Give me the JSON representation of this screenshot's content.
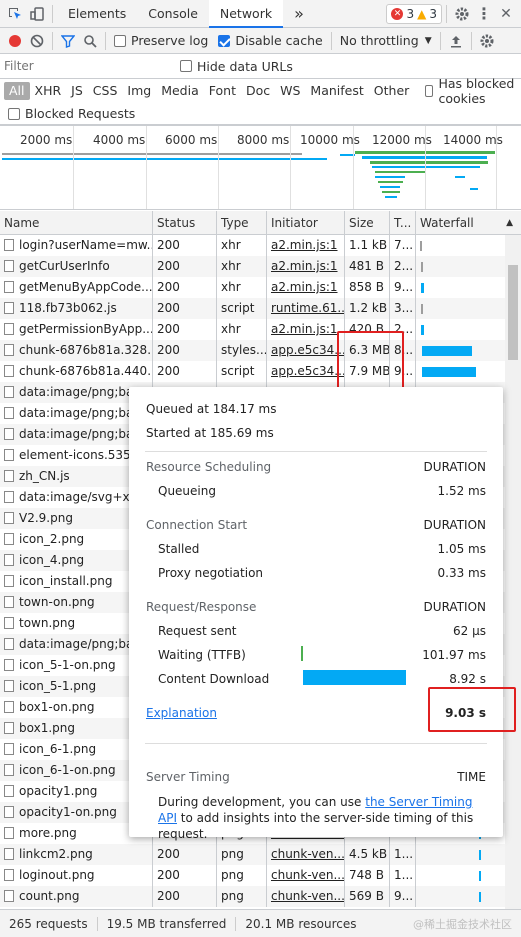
{
  "tabs": {
    "elements": "Elements",
    "console": "Console",
    "network": "Network",
    "more": "»",
    "errors": "3",
    "warnings": "3"
  },
  "toolbar": {
    "preserve_log": "Preserve log",
    "disable_cache": "Disable cache",
    "throttling": "No throttling"
  },
  "filter": {
    "placeholder": "Filter",
    "hide_data_urls": "Hide data URLs",
    "has_blocked_cookies": "Has blocked cookies",
    "blocked_requests": "Blocked Requests"
  },
  "types": [
    "All",
    "XHR",
    "JS",
    "CSS",
    "Img",
    "Media",
    "Font",
    "Doc",
    "WS",
    "Manifest",
    "Other"
  ],
  "overview_ticks": [
    "2000 ms",
    "4000 ms",
    "6000 ms",
    "8000 ms",
    "10000 ms",
    "12000 ms",
    "14000 ms"
  ],
  "columns": {
    "name": "Name",
    "status": "Status",
    "type": "Type",
    "initiator": "Initiator",
    "size": "Size",
    "time": "T...",
    "waterfall": "Waterfall"
  },
  "rows": [
    {
      "name": "login?userName=mw...",
      "status": "200",
      "type": "xhr",
      "initiator": "a2.min.js:1",
      "size": "1.1 kB",
      "time": "7..."
    },
    {
      "name": "getCurUserInfo",
      "status": "200",
      "type": "xhr",
      "initiator": "a2.min.js:1",
      "size": "481 B",
      "time": "2..."
    },
    {
      "name": "getMenuByAppCode...",
      "status": "200",
      "type": "xhr",
      "initiator": "a2.min.js:1",
      "size": "858 B",
      "time": "9..."
    },
    {
      "name": "118.fb73b062.js",
      "status": "200",
      "type": "script",
      "initiator": "runtime.61...",
      "size": "1.2 kB",
      "time": "3..."
    },
    {
      "name": "getPermissionByApp...",
      "status": "200",
      "type": "xhr",
      "initiator": "a2.min.js:1",
      "size": "420 B",
      "time": "2..."
    },
    {
      "name": "chunk-6876b81a.328...",
      "status": "200",
      "type": "styles...",
      "initiator": "app.e5c34...",
      "size": "6.3 MB",
      "time": "8..."
    },
    {
      "name": "chunk-6876b81a.440...",
      "status": "200",
      "type": "script",
      "initiator": "app.e5c34...",
      "size": "7.9 MB",
      "time": "9..."
    },
    {
      "name": "data:image/png;bas",
      "status": "",
      "type": "",
      "initiator": "",
      "size": "",
      "time": ""
    },
    {
      "name": "data:image/png;bas",
      "status": "",
      "type": "",
      "initiator": "",
      "size": "",
      "time": ""
    },
    {
      "name": "data:image/png;bas",
      "status": "",
      "type": "",
      "initiator": "",
      "size": "",
      "time": ""
    },
    {
      "name": "element-icons.53587",
      "status": "",
      "type": "",
      "initiator": "",
      "size": "",
      "time": ""
    },
    {
      "name": "zh_CN.js",
      "status": "",
      "type": "",
      "initiator": "",
      "size": "",
      "time": ""
    },
    {
      "name": "data:image/svg+xm",
      "status": "",
      "type": "",
      "initiator": "",
      "size": "",
      "time": ""
    },
    {
      "name": "V2.9.png",
      "status": "",
      "type": "",
      "initiator": "",
      "size": "",
      "time": ""
    },
    {
      "name": "icon_2.png",
      "status": "",
      "type": "",
      "initiator": "",
      "size": "",
      "time": ""
    },
    {
      "name": "icon_4.png",
      "status": "",
      "type": "",
      "initiator": "",
      "size": "",
      "time": ""
    },
    {
      "name": "icon_install.png",
      "status": "",
      "type": "",
      "initiator": "",
      "size": "",
      "time": ""
    },
    {
      "name": "town-on.png",
      "status": "",
      "type": "",
      "initiator": "",
      "size": "",
      "time": ""
    },
    {
      "name": "town.png",
      "status": "",
      "type": "",
      "initiator": "",
      "size": "",
      "time": ""
    },
    {
      "name": "data:image/png;bas",
      "status": "",
      "type": "",
      "initiator": "",
      "size": "",
      "time": ""
    },
    {
      "name": "icon_5-1-on.png",
      "status": "",
      "type": "",
      "initiator": "",
      "size": "",
      "time": ""
    },
    {
      "name": "icon_5-1.png",
      "status": "",
      "type": "",
      "initiator": "",
      "size": "",
      "time": ""
    },
    {
      "name": "box1-on.png",
      "status": "",
      "type": "",
      "initiator": "",
      "size": "",
      "time": ""
    },
    {
      "name": "box1.png",
      "status": "",
      "type": "",
      "initiator": "",
      "size": "",
      "time": ""
    },
    {
      "name": "icon_6-1.png",
      "status": "",
      "type": "",
      "initiator": "",
      "size": "",
      "time": ""
    },
    {
      "name": "icon_6-1-on.png",
      "status": "",
      "type": "",
      "initiator": "",
      "size": "",
      "time": ""
    },
    {
      "name": "opacity1.png",
      "status": "",
      "type": "",
      "initiator": "",
      "size": "",
      "time": ""
    },
    {
      "name": "opacity1-on.png",
      "status": "",
      "type": "",
      "initiator": "",
      "size": "",
      "time": ""
    },
    {
      "name": "more.png",
      "status": "",
      "type": "png",
      "initiator": "chunk-ven...",
      "size": "1.7 kB",
      "time": ""
    },
    {
      "name": "linkcm2.png",
      "status": "200",
      "type": "png",
      "initiator": "chunk-ven...",
      "size": "4.5 kB",
      "time": "1..."
    },
    {
      "name": "loginout.png",
      "status": "200",
      "type": "png",
      "initiator": "chunk-ven...",
      "size": "748 B",
      "time": "1..."
    },
    {
      "name": "count.png",
      "status": "200",
      "type": "png",
      "initiator": "chunk-ven...",
      "size": "569 B",
      "time": "9..."
    }
  ],
  "popup": {
    "queued": "Queued at 184.17 ms",
    "started": "Started at 185.69 ms",
    "resource_scheduling": "Resource Scheduling",
    "duration": "DURATION",
    "queueing": "Queueing",
    "queueing_v": "1.52 ms",
    "connection_start": "Connection Start",
    "stalled": "Stalled",
    "stalled_v": "1.05 ms",
    "proxy": "Proxy negotiation",
    "proxy_v": "0.33 ms",
    "req_resp": "Request/Response",
    "request_sent": "Request sent",
    "request_sent_v": "62 µs",
    "waiting": "Waiting (TTFB)",
    "waiting_v": "101.97 ms",
    "content_download": "Content Download",
    "content_download_v": "8.92 s",
    "explanation": "Explanation",
    "total": "9.03 s",
    "server_timing": "Server Timing",
    "time_label": "TIME",
    "st_text1": "During development, you can use ",
    "st_link": "the Server Timing API",
    "st_text2": " to add insights into the server-side timing of this request."
  },
  "status_bar": {
    "requests": "265 requests",
    "transferred": "19.5 MB transferred",
    "resources": "20.1 MB resources"
  },
  "watermark": "@稀土掘金技术社区",
  "colors": {
    "accent": "#1a73e8",
    "highlight": "#e02020",
    "download_bar": "#03a9f4"
  }
}
